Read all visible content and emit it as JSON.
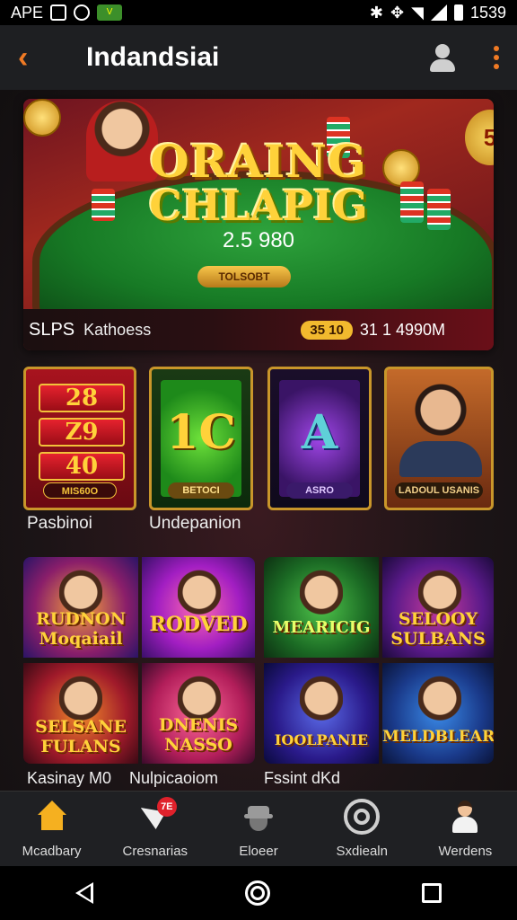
{
  "status_bar": {
    "carrier": "APE",
    "time": "1539"
  },
  "header": {
    "back_icon": "back-arrow-icon",
    "title": "Indandsiai",
    "accent": "#f07a24"
  },
  "hero": {
    "title_line1": "ORAING",
    "title_line2": "CHLAPIG",
    "amount": "2.5 980",
    "button_label": "TOLSOBT",
    "dice_label": "5",
    "footer_label": "SLPS",
    "footer_sub": "Kathoess",
    "footer_badge": "35 10",
    "footer_value": "31 1 4990M"
  },
  "game_cards": {
    "reels": [
      "28",
      "Z9",
      "40"
    ],
    "card1_button": "MIS60O",
    "card2_big": "1C",
    "card2_button": "BETOCI",
    "card3_big": "A",
    "card3_button": "ASRO",
    "card4_button": "LADOUL USANIS"
  },
  "row_labels": {
    "label1": "Pasbinoi",
    "label2": "Undepanion"
  },
  "tiles": [
    {
      "text": "RUDNON Moqaiail"
    },
    {
      "text": "RODVED"
    },
    {
      "text": "MEARICIG"
    },
    {
      "text": "SELOOY SULBANS"
    },
    {
      "text": "SELSANE FULANS"
    },
    {
      "text": "DNENIS NASSO"
    },
    {
      "text": "IOOLPANIE"
    },
    {
      "text": "MELDBLEAR"
    }
  ],
  "tile_labels": {
    "label1": "Kasinay M0",
    "label2": "Nulpicaoiom",
    "label3": "Fssint dKd"
  },
  "bottom_nav": {
    "items": [
      {
        "label": "Mcadbary",
        "icon": "home-icon",
        "active": true
      },
      {
        "label": "Cresnarias",
        "icon": "promo-icon",
        "badge": "7E"
      },
      {
        "label": "Eloeer",
        "icon": "agent-icon"
      },
      {
        "label": "Sxdiealn",
        "icon": "target-icon"
      },
      {
        "label": "Werdens",
        "icon": "person-icon"
      }
    ]
  }
}
